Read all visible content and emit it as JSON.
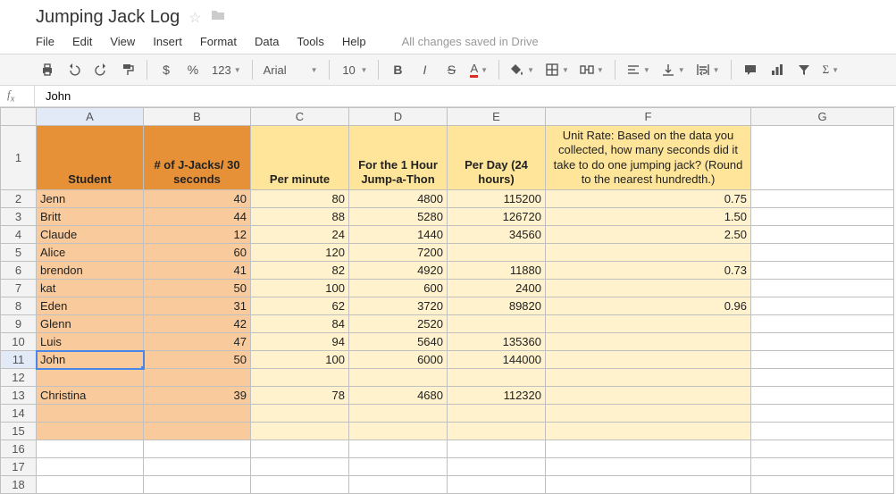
{
  "doc": {
    "title": "Jumping Jack Log"
  },
  "menu": {
    "file": "File",
    "edit": "Edit",
    "view": "View",
    "insert": "Insert",
    "format": "Format",
    "data": "Data",
    "tools": "Tools",
    "help": "Help",
    "saved": "All changes saved in Drive"
  },
  "toolbar": {
    "currency": "$",
    "percent": "%",
    "numfmt": "123",
    "font": "Arial",
    "size": "10"
  },
  "fx": {
    "value": "John"
  },
  "columns": [
    "A",
    "B",
    "C",
    "D",
    "E",
    "F",
    "G"
  ],
  "row_numbers": [
    1,
    2,
    3,
    4,
    5,
    6,
    7,
    8,
    9,
    10,
    11,
    12,
    13,
    14,
    15,
    16,
    17,
    18
  ],
  "active": {
    "col": "A",
    "row": 11
  },
  "selected_col": "A",
  "headers": {
    "A": "Student",
    "B": "# of J-Jacks/ 30 seconds",
    "C": "Per minute",
    "D": "For the 1 Hour Jump-a-Thon",
    "E": "Per Day (24 hours)",
    "F": "Unit Rate: Based on the data you collected, how many seconds did it take to do one jumping jack? (Round to the nearest hundredth.)"
  },
  "rows": [
    {
      "A": "Jenn",
      "B": "40",
      "C": "80",
      "D": "4800",
      "E": "115200",
      "F": "0.75"
    },
    {
      "A": "Britt",
      "B": "44",
      "C": "88",
      "D": "5280",
      "E": "126720",
      "F": "1.50"
    },
    {
      "A": "Claude",
      "B": "12",
      "C": "24",
      "D": "1440",
      "E": "34560",
      "F": "2.50"
    },
    {
      "A": "Alice",
      "B": "60",
      "C": "120",
      "D": "7200",
      "E": "",
      "F": ""
    },
    {
      "A": "brendon",
      "B": "41",
      "C": "82",
      "D": "4920",
      "E": "11880",
      "F": "0.73"
    },
    {
      "A": "kat",
      "B": "50",
      "C": "100",
      "D": "600",
      "E": "2400",
      "F": ""
    },
    {
      "A": "Eden",
      "B": "31",
      "C": "62",
      "D": "3720",
      "E": "89820",
      "F": "0.96"
    },
    {
      "A": "Glenn",
      "B": "42",
      "C": "84",
      "D": "2520",
      "E": "",
      "F": ""
    },
    {
      "A": "Luis",
      "B": "47",
      "C": "94",
      "D": "5640",
      "E": "135360",
      "F": ""
    },
    {
      "A": "John",
      "B": "50",
      "C": "100",
      "D": "6000",
      "E": "144000",
      "F": ""
    },
    {
      "A": "",
      "B": "",
      "C": "",
      "D": "",
      "E": "",
      "F": ""
    },
    {
      "A": "Christina",
      "B": "39",
      "C": "78",
      "D": "4680",
      "E": "112320",
      "F": ""
    },
    {
      "A": "",
      "B": "",
      "C": "",
      "D": "",
      "E": "",
      "F": ""
    },
    {
      "A": "",
      "B": "",
      "C": "",
      "D": "",
      "E": "",
      "F": ""
    }
  ]
}
